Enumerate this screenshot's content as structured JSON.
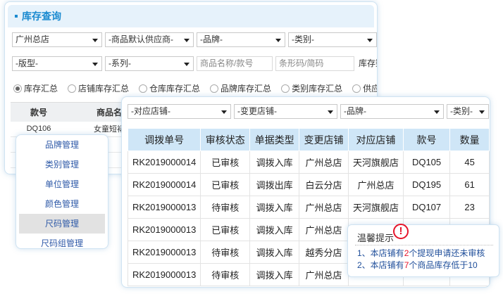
{
  "inventory": {
    "title": "库存查询",
    "filters_row1": [
      "广州总店",
      "-商品默认供应商-",
      "-品牌-",
      "-类别-"
    ],
    "filters_row2_selects": [
      "-版型-",
      "-系列-"
    ],
    "search_placeholder": "商品名称/款号",
    "barcode_placeholder": "条形码/简码",
    "stock_label": "库存数",
    "radios": [
      "库存汇总",
      "店铺库存汇总",
      "仓库库存汇总",
      "品牌库存汇总",
      "类别库存汇总",
      "供应商库"
    ],
    "table_headers": [
      "款号",
      "商品名"
    ],
    "rows": [
      [
        "DQ106",
        "女童短裙"
      ],
      [
        "",
        ""
      ],
      [
        "",
        ""
      ]
    ]
  },
  "menu": {
    "items": [
      "品牌管理",
      "类别管理",
      "单位管理",
      "颜色管理",
      "尺码管理",
      "尺码组管理"
    ]
  },
  "transfer": {
    "filters": [
      "-对应店铺-",
      "-变更店铺-",
      "-品牌-",
      "-类别-"
    ],
    "headers": [
      "调拨单号",
      "审核状态",
      "单据类型",
      "变更店铺",
      "对应店铺",
      "款号",
      "数量"
    ],
    "rows": [
      [
        "RK2019000014",
        "已审核",
        "调拨入库",
        "广州总店",
        "天河旗舰店",
        "DQ105",
        "45"
      ],
      [
        "RK2019000014",
        "已审核",
        "调拨出库",
        "白云分店",
        "广州总店",
        "DQ195",
        "61"
      ],
      [
        "RK2019000013",
        "待审核",
        "调拨入库",
        "广州总店",
        "天河旗舰店",
        "DQ107",
        "23"
      ],
      [
        "RK2019000013",
        "已审核",
        "调拨入库",
        "广州总店",
        "",
        "",
        " "
      ],
      [
        "RK2019000013",
        "待审核",
        "调拨入库",
        "越秀分店",
        "",
        "",
        " "
      ],
      [
        "RK2019000013",
        "待审核",
        "调拨入库",
        "广州总店",
        "",
        "",
        ""
      ]
    ]
  },
  "tip": {
    "title": "温馨提示",
    "line1_prefix": "1、本店铺有",
    "line1_count": "2",
    "line1_suffix": "个提现申请还未审核",
    "line2_prefix": "2、本店铺有",
    "line2_count": "7",
    "line2_suffix": "个商品库存低于10",
    "warn_glyph": "!"
  },
  "colors": {
    "accent": "#1a8ad0",
    "header_bg": "#cfe6f7",
    "warn": "#e5142a",
    "link": "#2f5aa8"
  }
}
